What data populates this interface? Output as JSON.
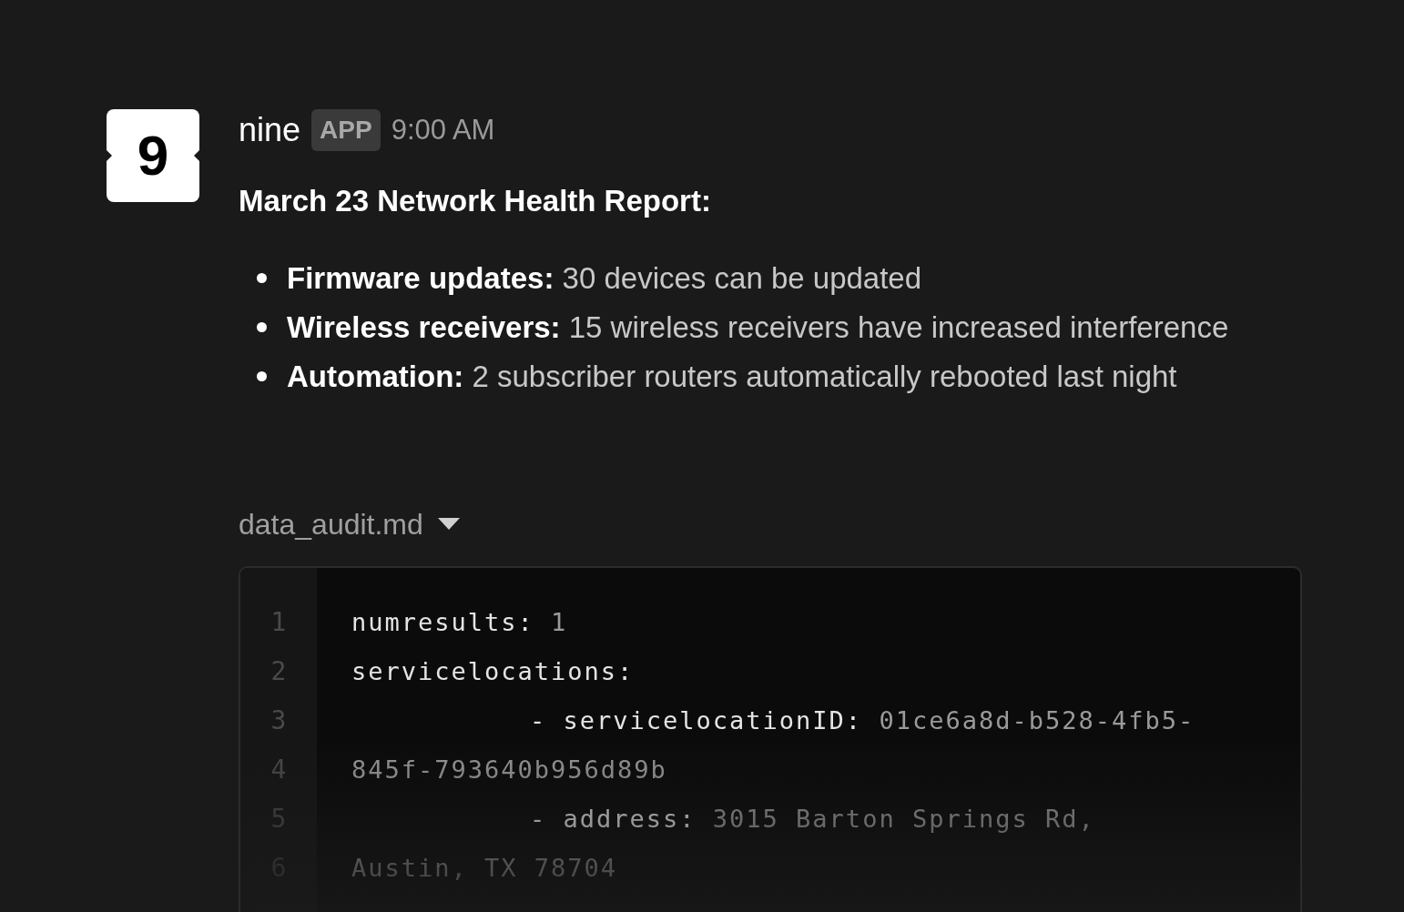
{
  "message": {
    "avatar": {
      "text": "9"
    },
    "sender": "nine",
    "badge": "APP",
    "time": "9:00 AM",
    "title": "March 23 Network Health Report:",
    "bullets": [
      {
        "label": "Firmware updates:",
        "text": "30 devices can be updated"
      },
      {
        "label": "Wireless receivers:",
        "text": "15 wireless receivers have increased interference"
      },
      {
        "label": "Automation:",
        "text": "2 subscriber routers automatically rebooted last night"
      }
    ],
    "attachment": {
      "filename": "data_audit.md",
      "expanded": true,
      "lines": [
        {
          "number": "1",
          "indent": false,
          "key": "numresults:",
          "value": "1"
        },
        {
          "number": "2",
          "indent": false,
          "key": "servicelocations:"
        },
        {
          "number": "3",
          "indent": true,
          "key": "- servicelocationID:",
          "value": "01ce6a8d-b528-4fb5-"
        },
        {
          "number": "4",
          "indent": false,
          "value": "845f-793640b956d89b"
        },
        {
          "number": "5",
          "indent": true,
          "key": "- address:",
          "value": "3015 Barton Springs Rd,"
        },
        {
          "number": "6",
          "indent": false,
          "value": "Austin, TX 78704"
        }
      ]
    }
  }
}
